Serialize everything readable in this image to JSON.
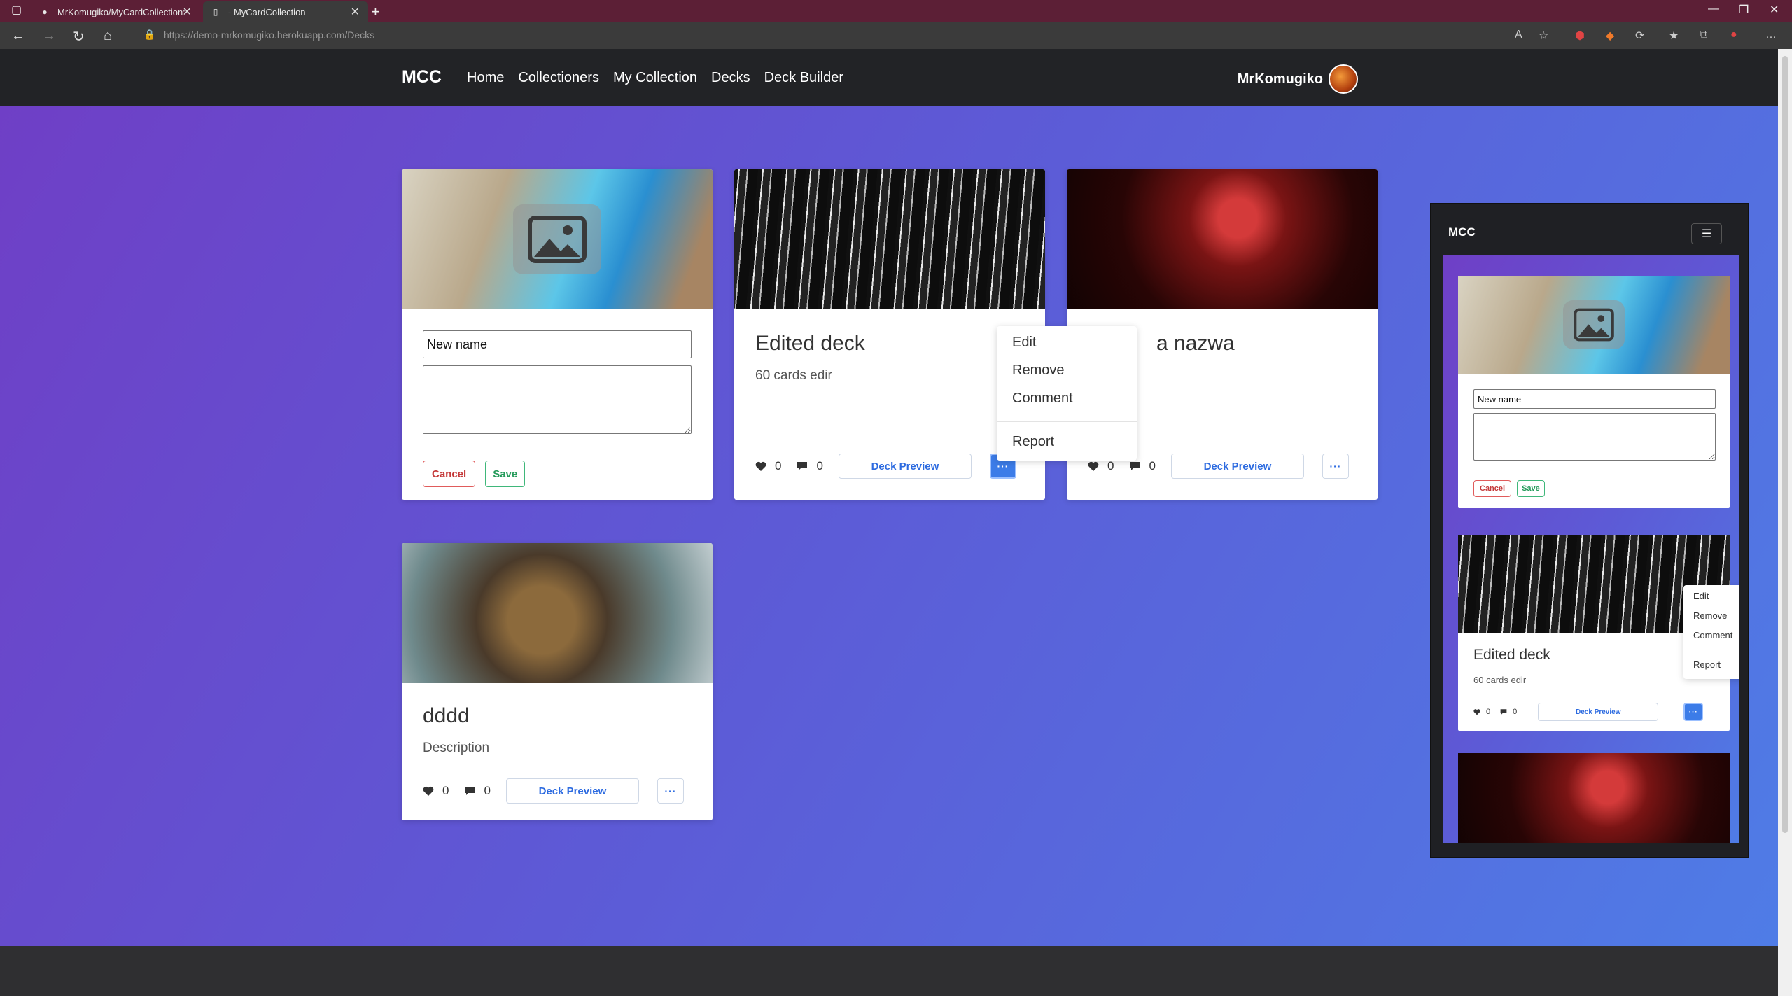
{
  "browser": {
    "tabs": [
      {
        "title": "MrKomugiko/MyCardCollection:",
        "active": false
      },
      {
        "title": "- MyCardCollection",
        "active": true
      }
    ],
    "url_host": "https://demo-mrkomugiko.herokuapp.com",
    "url_path": "/Decks"
  },
  "site": {
    "brand": "MCC",
    "nav": [
      "Home",
      "Collectioners",
      "My Collection",
      "Decks",
      "Deck Builder"
    ],
    "username": "MrKomugiko"
  },
  "edit_card": {
    "name_value": "New name",
    "cancel": "Cancel",
    "save": "Save"
  },
  "decks": [
    {
      "title": "Edited deck",
      "description": "60 cards edir",
      "likes": "0",
      "comments": "0",
      "preview": "Deck Preview"
    },
    {
      "title": "a nazwa",
      "description": "",
      "likes": "0",
      "comments": "0",
      "preview": "Deck Preview"
    },
    {
      "title": "dddd",
      "description": "Description",
      "likes": "0",
      "comments": "0",
      "preview": "Deck Preview"
    }
  ],
  "menu": {
    "items": [
      "Edit",
      "Remove",
      "Comment"
    ],
    "report": "Report"
  },
  "colors": {
    "accent": "#2d6be0",
    "nav_bg": "#222326",
    "gradient_start": "#6f3fc6",
    "gradient_end": "#4f7ce6",
    "cancel": "#c43a3a",
    "save": "#249a5a"
  }
}
